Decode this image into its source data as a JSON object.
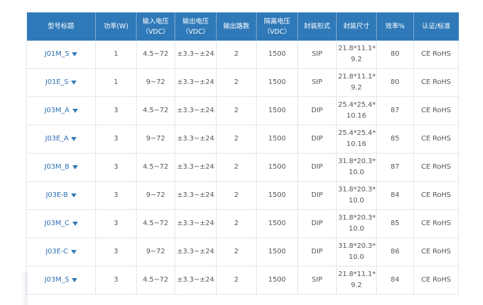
{
  "table": {
    "headers": [
      {
        "label": "型号标题"
      },
      {
        "label": "功率(W)"
      },
      {
        "label": "输入电压",
        "sub": "（VDC）"
      },
      {
        "label": "输出电压",
        "sub": "（VDC）"
      },
      {
        "label": "输出路数"
      },
      {
        "label": "隔离电压",
        "sub": "（VDC）"
      },
      {
        "label": "封装形式"
      },
      {
        "label": "封装尺寸"
      },
      {
        "label": "效率%"
      },
      {
        "label": "认证/标准"
      }
    ],
    "rows": [
      {
        "model": "J01M_S",
        "power": "1",
        "vin": "4.5~72",
        "vout": "±3.3~±24",
        "channels": "2",
        "isolation": "1500",
        "package": "SIP",
        "size_a": "21.8*11.1*",
        "size_b": "9.2",
        "efficiency": "80",
        "cert": "CE RoHS"
      },
      {
        "model": "J01E_S",
        "power": "1",
        "vin": "9~72",
        "vout": "±3.3~±24",
        "channels": "2",
        "isolation": "1500",
        "package": "SIP",
        "size_a": "21.8*11.1*",
        "size_b": "9.2",
        "efficiency": "80",
        "cert": "CE RoHS"
      },
      {
        "model": "J03M_A",
        "power": "3",
        "vin": "4.5~72",
        "vout": "±3.3~±24",
        "channels": "2",
        "isolation": "1500",
        "package": "DIP",
        "size_a": "25.4*25.4*",
        "size_b": "10.16",
        "efficiency": "87",
        "cert": "CE RoHS"
      },
      {
        "model": "J03E_A",
        "power": "3",
        "vin": "9~72",
        "vout": "±3.3~±24",
        "channels": "2",
        "isolation": "1500",
        "package": "DIP",
        "size_a": "25.4*25.4*",
        "size_b": "10.16",
        "efficiency": "85",
        "cert": "CE RoHS"
      },
      {
        "model": "J03M_B",
        "power": "3",
        "vin": "4.5~72",
        "vout": "±3.3~±24",
        "channels": "2",
        "isolation": "1500",
        "package": "DIP",
        "size_a": "31.8*20.3*",
        "size_b": "10.0",
        "efficiency": "87",
        "cert": "CE RoHS"
      },
      {
        "model": "J03E-B",
        "power": "3",
        "vin": "9~72",
        "vout": "±3.3~±24",
        "channels": "2",
        "isolation": "1500",
        "package": "DIP",
        "size_a": "31.8*20.3*",
        "size_b": "10.0",
        "efficiency": "84",
        "cert": "CE RoHS"
      },
      {
        "model": "J03M_C",
        "power": "3",
        "vin": "4.5~72",
        "vout": "±3.3~±24",
        "channels": "2",
        "isolation": "1500",
        "package": "DIP",
        "size_a": "31.8*20.3*",
        "size_b": "10.0",
        "efficiency": "85",
        "cert": "CE RoHS"
      },
      {
        "model": "J03E-C",
        "power": "3",
        "vin": "9~72",
        "vout": "±3.3~±24",
        "channels": "2",
        "isolation": "1500",
        "package": "DIP",
        "size_a": "31.8*20.3*",
        "size_b": "10.0",
        "efficiency": "86",
        "cert": "CE RoHS"
      },
      {
        "model": "J03M_S",
        "power": "3",
        "vin": "4.5~72",
        "vout": "±3.3~±24",
        "channels": "2",
        "isolation": "1500",
        "package": "SIP",
        "size_a": "21.8*11.1*",
        "size_b": "9.2",
        "efficiency": "84",
        "cert": "CE RoHS"
      }
    ]
  },
  "icons": {
    "model_dropdown": "caret-down-icon"
  },
  "colors": {
    "header_bg": "#2f79b8",
    "header_text": "#ffffff",
    "link": "#2c6fb4",
    "border": "#dfe6ec"
  }
}
